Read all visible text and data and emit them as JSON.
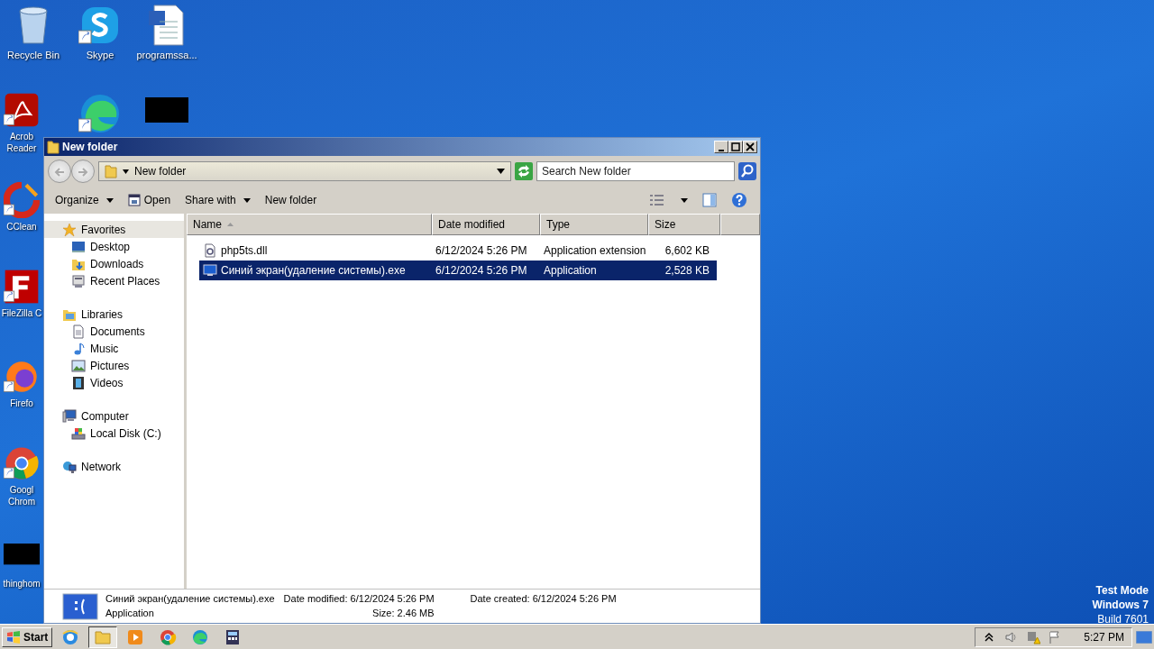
{
  "desktop_icons": [
    {
      "kind": "bin",
      "lines": [
        "Recycle Bin"
      ],
      "shortcut": false
    },
    {
      "kind": "skype",
      "lines": [
        "Skype"
      ],
      "shortcut": true
    },
    {
      "kind": "doc",
      "lines": [
        "programssa..."
      ],
      "shortcut": false
    },
    {
      "kind": "pdf",
      "lines": [
        "Acrob",
        "Reader"
      ],
      "shortcut": true
    },
    {
      "kind": "edge",
      "shortcut": true
    },
    {
      "kind": "black",
      "shortcut": false
    },
    {
      "kind": "ccleaner",
      "lines": [
        "CClean"
      ],
      "shortcut": true
    },
    {
      "kind": "filezilla",
      "lines": [
        "FileZilla C"
      ],
      "shortcut": true
    },
    {
      "kind": "firefox",
      "lines": [
        "Firefo"
      ],
      "shortcut": true
    },
    {
      "kind": "chrome",
      "lines": [
        "Googl",
        "Chrom"
      ],
      "shortcut": true
    },
    {
      "kind": "black",
      "lines": [
        "thinghom"
      ],
      "shortcut": false
    }
  ],
  "window": {
    "title": "New folder",
    "address": "New folder",
    "search": {
      "placeholder": "Search New folder"
    },
    "toolbar": [
      {
        "label": "Organize",
        "dropdown": true,
        "kind": "text"
      },
      {
        "label": "Open",
        "dropdown": false,
        "kind": "open"
      },
      {
        "label": "Share with",
        "dropdown": true,
        "kind": "text"
      },
      {
        "label": "New folder",
        "dropdown": false,
        "kind": "text"
      }
    ],
    "nav": [
      {
        "label": "Favorites",
        "selected": true,
        "children": [
          {
            "label": "Desktop"
          },
          {
            "label": "Downloads"
          },
          {
            "label": "Recent Places"
          }
        ]
      },
      {
        "label": "Libraries",
        "selected": false,
        "children": [
          {
            "label": "Documents"
          },
          {
            "label": "Music"
          },
          {
            "label": "Pictures"
          },
          {
            "label": "Videos"
          }
        ]
      },
      {
        "label": "Computer",
        "selected": false,
        "children": [
          {
            "label": "Local Disk (C:)"
          }
        ]
      },
      {
        "label": "Network",
        "selected": false
      }
    ],
    "columns": [
      {
        "label": "Name",
        "sorted": true
      },
      {
        "label": "Date modified",
        "sorted": false
      },
      {
        "label": "Type",
        "sorted": false
      },
      {
        "label": "Size",
        "sorted": false
      }
    ],
    "files": [
      {
        "name": "php5ts.dll",
        "date": "6/12/2024 5:26 PM",
        "type": "Application extension",
        "size": "6,602 KB",
        "kind": "dll",
        "selected": false
      },
      {
        "name": "Синий экран(удаление системы).exe",
        "date": "6/12/2024 5:26 PM",
        "type": "Application",
        "size": "2,528 KB",
        "kind": "exe",
        "selected": true
      }
    ],
    "details": {
      "name": "Синий экран(удаление системы).exe",
      "type": "Application",
      "modified_label": "Date modified:",
      "modified": "6/12/2024 5:26 PM",
      "created_label": "Date created:",
      "created": "6/12/2024 5:26 PM",
      "size_label": "Size:",
      "size": "2.46 MB"
    }
  },
  "os_notice": [
    "Test Mode",
    "Windows 7",
    "Build 7601"
  ],
  "taskbar": {
    "start": "Start",
    "apps": [
      {
        "kind": "ie",
        "selected": false
      },
      {
        "kind": "explorer",
        "selected": true
      },
      {
        "kind": "media",
        "selected": false
      },
      {
        "kind": "chrome",
        "selected": false
      },
      {
        "kind": "edge",
        "selected": false
      },
      {
        "kind": "app",
        "selected": false
      }
    ],
    "clock": "5:27 PM"
  }
}
